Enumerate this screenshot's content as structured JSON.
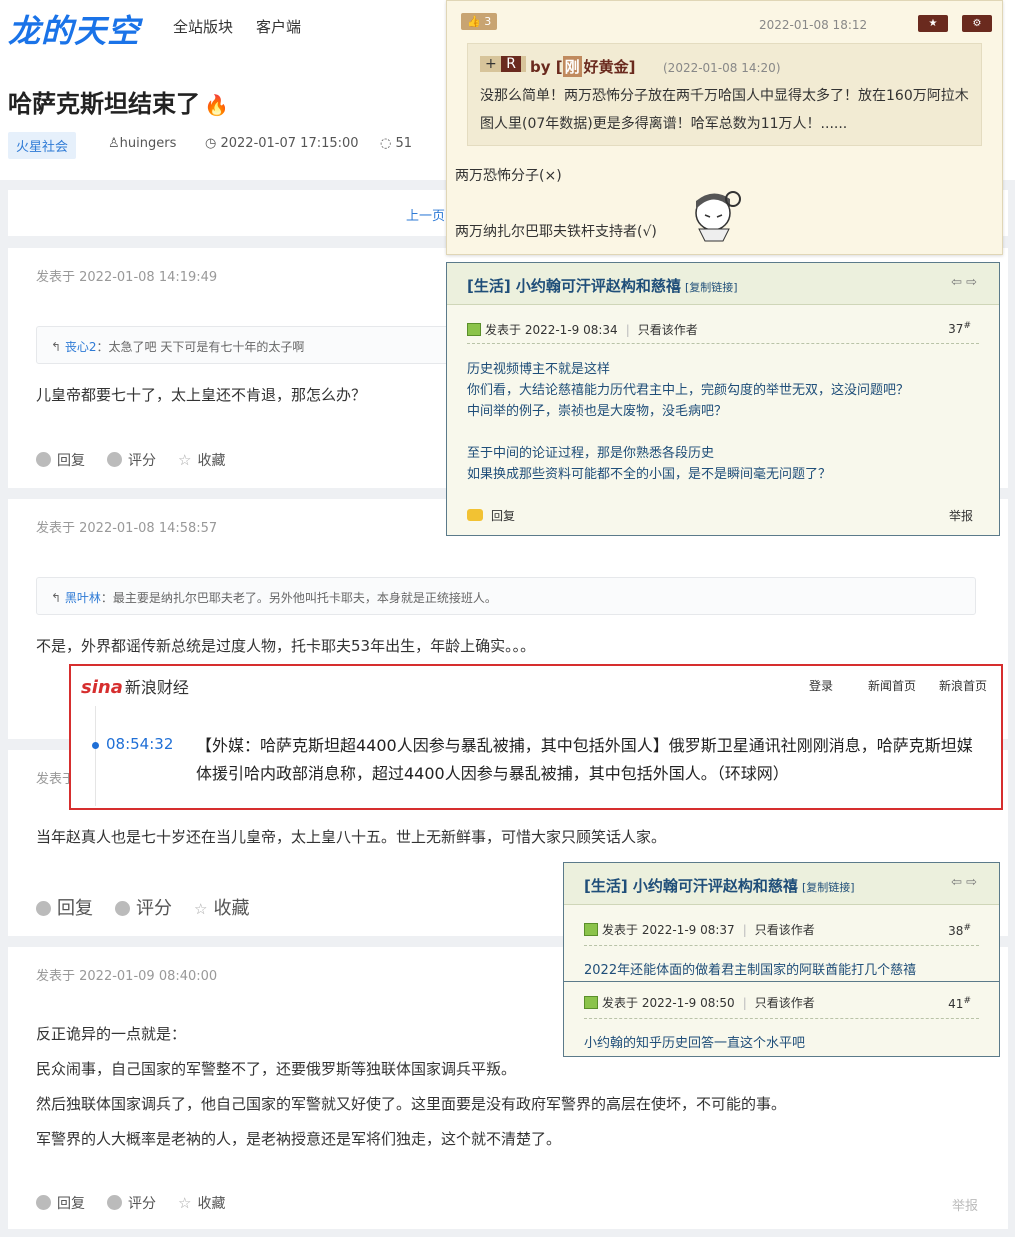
{
  "site": {
    "logo": "龙的天空",
    "nav": [
      "全站版块",
      "客户端"
    ]
  },
  "thread": {
    "title": "哈萨克斯坦结束了",
    "fire_icon": "fire-icon",
    "tag": "火星社会",
    "author": "huingers",
    "date": "2022-01-07 17:15:00",
    "comment_count": "51"
  },
  "pager": {
    "prev": "上一页"
  },
  "posts": [
    {
      "time": "发表于 2022-01-08 14:19:49",
      "quote_name": "丧心2",
      "quote_text": "：太急了吧 天下可是有七十年的太子啊",
      "body": "儿皇帝都要七十了，太上皇还不肯退，那怎么办？"
    },
    {
      "time": "发表于 2022-01-08 14:58:57",
      "quote_name": "黑叶林",
      "quote_text": "：最主要是纳扎尔巴耶夫老了。另外他叫托卡耶夫，本身就是正统接班人。",
      "body": "不是，外界都谣传新总统是过度人物，托卡耶夫53年出生，年龄上确实。。。"
    },
    {
      "time": "发表于",
      "body": "当年赵真人也是七十岁还在当儿皇帝，太上皇八十五。世上无新鲜事，可惜大家只顾笑话人家。"
    },
    {
      "time": "发表于 2022-01-09 08:40:00",
      "lines": [
        "反正诡异的一点就是：",
        "民众闹事，自己国家的军警整不了，还要俄罗斯等独联体国家调兵平叛。",
        "然后独联体国家调兵了，他自己国家的军警就又好使了。这里面要是没有政府军警界的高层在使坏，不可能的事。",
        "军警界的人大概率是老衲的人，是老衲授意还是军将们独走，这个就不清楚了。"
      ],
      "report": "举报"
    }
  ],
  "actions": {
    "reply": "回复",
    "rate": "评分",
    "fav": "收藏"
  },
  "overlay_quote": {
    "likes": "3",
    "date": "2022-01-08 18:12",
    "plus": "+",
    "r": "R",
    "by": "by",
    "by_badge": "刚",
    "by_name": "好黄金",
    "quote_date": "(2022-01-08 14:20)",
    "quote_text": "没那么简单！两万恐怖分子放在两千万哈国人中显得太多了！放在160万阿拉木图人里(07年数据)更是多得离谱！哈军总数为11万人！......",
    "line1": "两万恐怖分子(×)",
    "line2": "两万纳扎尔巴耶夫铁杆支持者(√)"
  },
  "overlay_forum1": {
    "title": "[生活] 小约翰可汗评赵构和慈禧",
    "copy_link": "[复制链接]",
    "post_date": "发表于 2022-1-9 08:34",
    "only_author": "只看该作者",
    "floor": "37",
    "body_lines": [
      "历史视频博主不就是这样",
      "你们看，大结论慈禧能力历代君主中上，完颜勾度的举世无双，这没问题吧？",
      "中间举的例子，崇祯也是大废物，没毛病吧？",
      "",
      "至于中间的论证过程，那是你熟悉各段历史",
      "如果换成那些资料可能都不全的小国，是不是瞬间毫无问题了？"
    ],
    "reply": "回复",
    "report": "举报"
  },
  "overlay_sina": {
    "logo": "sina",
    "logo_text": "新浪财经",
    "nav": [
      "登录",
      "新闻首页",
      "新浪首页"
    ],
    "time": "08:54:32",
    "news": "【外媒：哈萨克斯坦超4400人因参与暴乱被捕，其中包括外国人】俄罗斯卫星通讯社刚刚消息，哈萨克斯坦媒体援引哈内政部消息称，超过4400人因参与暴乱被捕，其中包括外国人。（环球网）"
  },
  "overlay_forum2": {
    "title": "[生活] 小约翰可汗评赵构和慈禧",
    "copy_link": "[复制链接]",
    "posts": [
      {
        "date": "发表于 2022-1-9 08:37",
        "only_author": "只看该作者",
        "floor": "38",
        "body": "2022年还能体面的做着君主制国家的阿联酋能打几个慈禧"
      },
      {
        "date": "发表于 2022-1-9 08:50",
        "only_author": "只看该作者",
        "floor": "41",
        "body": "小约翰的知乎历史回答一直这个水平吧"
      }
    ]
  }
}
